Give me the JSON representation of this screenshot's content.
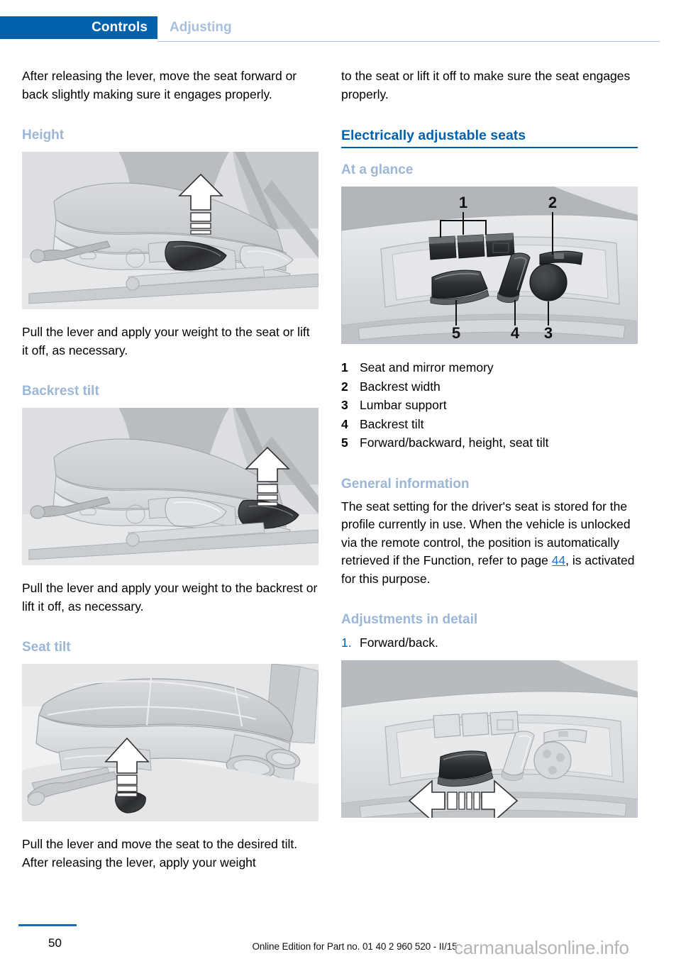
{
  "header": {
    "active_tab": "Controls",
    "inactive_tab": "Adjusting"
  },
  "colors": {
    "brand_blue": "#0061ad",
    "light_blue_heading": "#9bb6d6",
    "inactive_tab_blue": "#a8c0de",
    "page_link_blue": "#2f6fc4"
  },
  "left_column": {
    "intro_paragraph": "After releasing the lever, move the seat forward or back slightly making sure it engages properly.",
    "height_heading": "Height",
    "height_caption": "Pull the lever and apply your weight to the seat or lift it off, as necessary.",
    "backrest_tilt_heading": "Backrest tilt",
    "backrest_tilt_caption": "Pull the lever and apply your weight to the backrest or lift it off, as necessary.",
    "seat_tilt_heading": "Seat tilt",
    "seat_tilt_caption": "Pull the lever and move the seat to the desired tilt. After releasing the lever, apply your weight",
    "figures": {
      "height": "seat-height-lever-illustration",
      "backrest_tilt": "seat-backrest-tilt-lever-illustration",
      "seat_tilt": "seat-tilt-lever-illustration"
    }
  },
  "right_column": {
    "continued_paragraph": "to the seat or lift it off to make sure the seat engages properly.",
    "main_heading": "Electrically adjustable seats",
    "at_a_glance_heading": "At a glance",
    "control_panel_figure": "seat-control-panel-illustration",
    "legend": [
      {
        "num": "1",
        "label": "Seat and mirror memory"
      },
      {
        "num": "2",
        "label": "Backrest width"
      },
      {
        "num": "3",
        "label": "Lumbar support"
      },
      {
        "num": "4",
        "label": "Backrest tilt"
      },
      {
        "num": "5",
        "label": "Forward/backward, height, seat tilt"
      }
    ],
    "general_information_heading": "General information",
    "general_information_text_before": "The seat setting for the driver's seat is stored for the profile currently in use. When the vehicle is unlocked via the remote control, the position is automatically retrieved if the Function, refer to page ",
    "general_information_page_ref": "44",
    "general_information_text_after": ", is activated for this purpose.",
    "adjustments_heading": "Adjustments in detail",
    "steps": [
      {
        "num": "1.",
        "label": "Forward/back."
      }
    ],
    "step_figure": "seat-forward-back-control-illustration"
  },
  "footer": {
    "page_number": "50",
    "edition_text": "Online Edition for Part no. 01 40 2 960 520 - II/15",
    "watermark": "carmanualsonline.info"
  }
}
